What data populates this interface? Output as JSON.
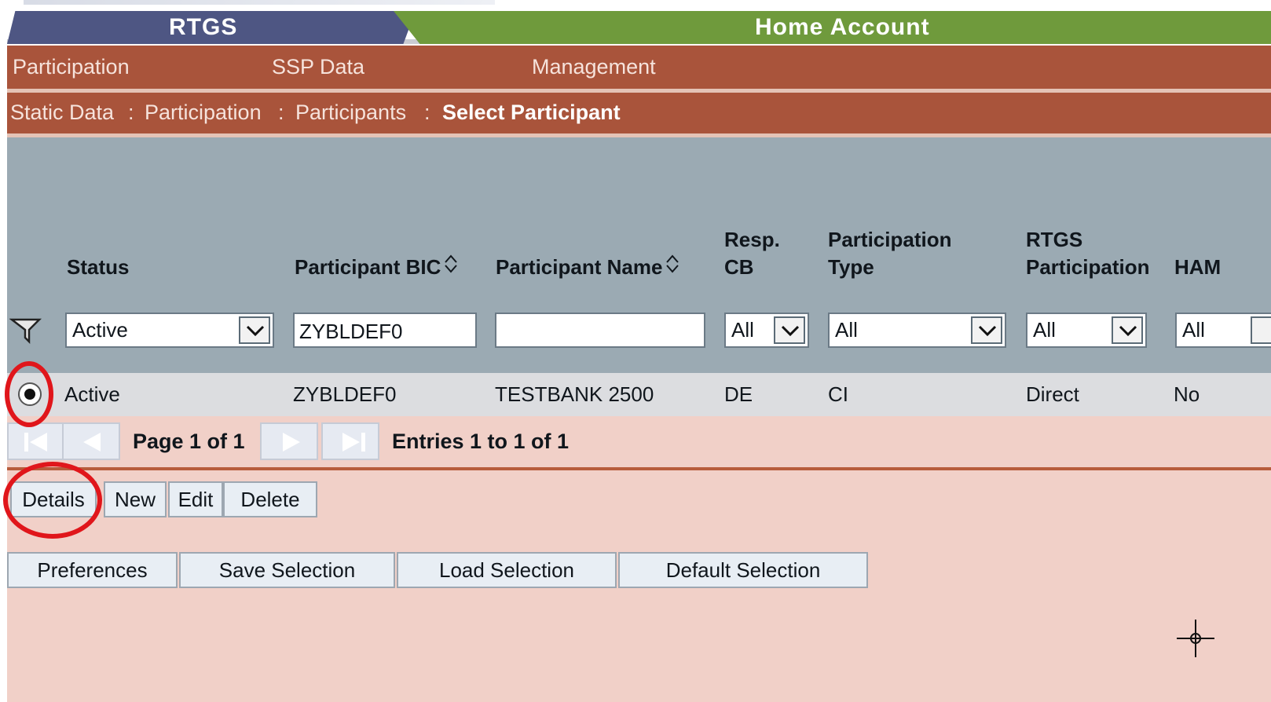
{
  "tabs": {
    "rtgs": "RTGS",
    "ham": "Home Account"
  },
  "menu": {
    "items": [
      "Participation",
      "SSP Data",
      "Management"
    ]
  },
  "breadcrumb": {
    "items": [
      "Static Data",
      "Participation",
      "Participants"
    ],
    "current": "Select Participant",
    "separator": ":"
  },
  "table": {
    "headers": {
      "status": "Status",
      "bic": "Participant BIC",
      "name": "Participant Name",
      "resp_cb_1": "Resp.",
      "resp_cb_2": "CB",
      "ptype_1": "Participation",
      "ptype_2": "Type",
      "rtgs_1": "RTGS",
      "rtgs_2": "Participation",
      "ham": "HAM"
    },
    "filters": {
      "status": "Active",
      "bic": "ZYBLDEF0",
      "name": "",
      "resp_cb": "All",
      "ptype": "All",
      "rtgs": "All",
      "ham": "All"
    },
    "row": {
      "status": "Active",
      "bic": "ZYBLDEF0",
      "name": "TESTBANK 2500",
      "resp_cb": "DE",
      "ptype": "CI",
      "rtgs": "Direct",
      "ham": "No"
    }
  },
  "pager": {
    "page": "Page 1 of 1",
    "entries": "Entries 1 to 1 of 1"
  },
  "actions": {
    "details": "Details",
    "new": "New",
    "edit": "Edit",
    "delete": "Delete"
  },
  "selection": {
    "preferences": "Preferences",
    "save": "Save Selection",
    "load": "Load Selection",
    "default": "Default Selection"
  },
  "colors": {
    "rtgs_tab": "#4e5683",
    "ham_tab": "#6f9a3c",
    "menu_bar": "#a9543b",
    "header_area": "#9baab3",
    "body_bg": "#f1d0c8",
    "annotation": "#e0161b"
  },
  "icons": [
    "filter-icon",
    "sort-icon",
    "chevron-down-icon",
    "first-page-icon",
    "prev-page-icon",
    "next-page-icon",
    "last-page-icon",
    "crosshair-cursor-icon"
  ]
}
